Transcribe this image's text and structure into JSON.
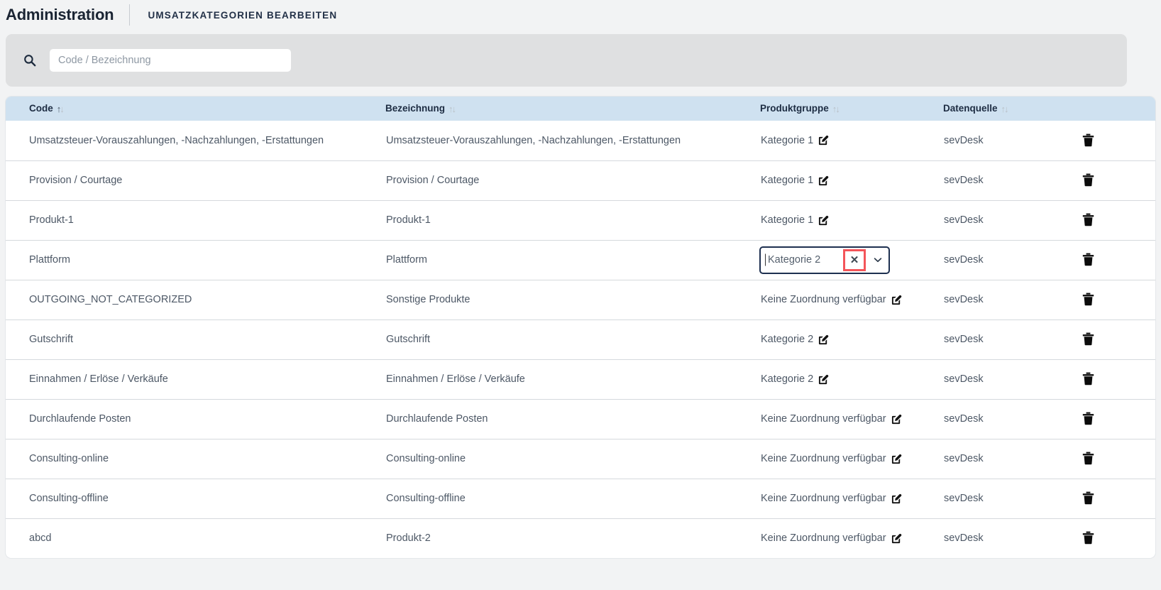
{
  "header": {
    "app_title": "Administration",
    "page_title": "UMSATZKATEGORIEN BEARBEITEN"
  },
  "search": {
    "placeholder": "Code / Bezeichnung",
    "value": "",
    "icon": "search-icon"
  },
  "table": {
    "columns": [
      {
        "label": "Code",
        "sort": "asc"
      },
      {
        "label": "Bezeichnung",
        "sort": "none"
      },
      {
        "label": "Produktgruppe",
        "sort": "none"
      },
      {
        "label": "Datenquelle",
        "sort": "none"
      },
      {
        "label": "",
        "sort": "none"
      }
    ],
    "rows": [
      {
        "code": "Umsatzsteuer-Vorauszahlungen, -Nachzahlungen, -Erstattungen",
        "bezeichnung": "Umsatzsteuer-Vorauszahlungen, -Nachzahlungen, -Erstattungen",
        "produktgruppe": "Kategorie 1",
        "datenquelle": "sevDesk",
        "editing": false
      },
      {
        "code": "Provision / Courtage",
        "bezeichnung": "Provision / Courtage",
        "produktgruppe": "Kategorie 1",
        "datenquelle": "sevDesk",
        "editing": false
      },
      {
        "code": "Produkt-1",
        "bezeichnung": "Produkt-1",
        "produktgruppe": "Kategorie 1",
        "datenquelle": "sevDesk",
        "editing": false
      },
      {
        "code": "Plattform",
        "bezeichnung": "Plattform",
        "produktgruppe": "Kategorie 2",
        "datenquelle": "sevDesk",
        "editing": true
      },
      {
        "code": "OUTGOING_NOT_CATEGORIZED",
        "bezeichnung": "Sonstige Produkte",
        "produktgruppe": "Keine Zuordnung verfügbar",
        "datenquelle": "sevDesk",
        "editing": false
      },
      {
        "code": "Gutschrift",
        "bezeichnung": "Gutschrift",
        "produktgruppe": "Kategorie 2",
        "datenquelle": "sevDesk",
        "editing": false
      },
      {
        "code": "Einnahmen / Erlöse / Verkäufe",
        "bezeichnung": "Einnahmen / Erlöse / Verkäufe",
        "produktgruppe": "Kategorie 2",
        "datenquelle": "sevDesk",
        "editing": false
      },
      {
        "code": "Durchlaufende Posten",
        "bezeichnung": "Durchlaufende Posten",
        "produktgruppe": "Keine Zuordnung verfügbar",
        "datenquelle": "sevDesk",
        "editing": false
      },
      {
        "code": "Consulting-online",
        "bezeichnung": "Consulting-online",
        "produktgruppe": "Keine Zuordnung verfügbar",
        "datenquelle": "sevDesk",
        "editing": false
      },
      {
        "code": "Consulting-offline",
        "bezeichnung": "Consulting-offline",
        "produktgruppe": "Keine Zuordnung verfügbar",
        "datenquelle": "sevDesk",
        "editing": false
      },
      {
        "code": "abcd",
        "bezeichnung": "Produkt-2",
        "produktgruppe": "Keine Zuordnung verfügbar",
        "datenquelle": "sevDesk",
        "editing": false
      }
    ]
  },
  "select_editor": {
    "value": "Kategorie 2",
    "clear_label": "✕",
    "clear_icon": "close-icon",
    "chevron_icon": "chevron-down-icon",
    "highlight_color": "#f4555a",
    "border_color": "#1e3050"
  },
  "icons": {
    "edit": "edit-pencil-icon",
    "delete": "trash-icon",
    "sort": "sort-arrows-icon"
  },
  "colors": {
    "page_bg": "#f2f3f4",
    "panel_bg": "#dfe0e1",
    "table_header_bg": "#cfe1f0",
    "text": "#4d5866",
    "heading": "#1d2c42"
  }
}
